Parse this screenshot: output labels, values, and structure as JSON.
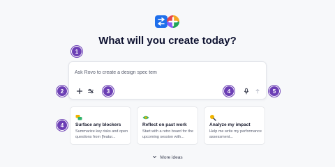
{
  "header": {
    "logo_icon": "rovo-logo-icon",
    "title": "What will you create today?"
  },
  "prompt": {
    "value": "Ask Rovo to create a design spec tem",
    "placeholder": ""
  },
  "toolbar": {
    "add_icon": "plus-icon",
    "settings_icon": "sliders-icon",
    "mic_icon": "microphone-icon",
    "send_icon": "arrow-up-icon"
  },
  "annotations": [
    "1",
    "2",
    "3",
    "4",
    "5",
    "4"
  ],
  "cards": [
    {
      "title": "Surface any blockers",
      "desc": "Summarize key risks and open questions from [featur...",
      "icon": "chat-bubbles-icon",
      "icon_color": "#f0b400"
    },
    {
      "title": "Reflect on past work",
      "desc": "Start with a retro board for the upcoming session with...",
      "icon": "eye-icon",
      "icon_color": "#2fb36b"
    },
    {
      "title": "Analyze my impact",
      "desc": "Help me write my performance assessment...",
      "icon": "magnifier-icon",
      "icon_color": "#f0b400"
    }
  ],
  "more": {
    "label": "More ideas",
    "icon": "chevron-down-icon"
  },
  "colors": {
    "accent": "#6c3fb5",
    "brand_blue": "#1f6feb"
  }
}
